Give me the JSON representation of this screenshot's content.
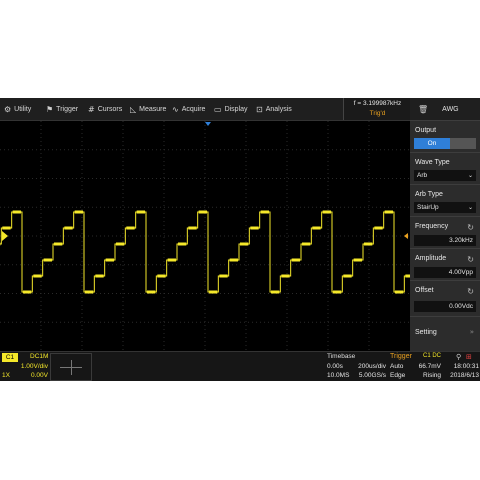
{
  "menu": {
    "items": [
      {
        "name": "utility",
        "icon": "gear-icon",
        "label": "Utility"
      },
      {
        "name": "trigger",
        "icon": "flag-icon",
        "label": "Trigger"
      },
      {
        "name": "cursors",
        "icon": "hash-icon",
        "label": "Cursors"
      },
      {
        "name": "measure",
        "icon": "ruler-icon",
        "label": "Measure"
      },
      {
        "name": "acquire",
        "icon": "wave-icon",
        "label": "Acquire"
      },
      {
        "name": "display",
        "icon": "monitor-icon",
        "label": "Display"
      },
      {
        "name": "analysis",
        "icon": "chart-icon",
        "label": "Analysis"
      }
    ]
  },
  "trigger_status": {
    "frequency": "f = 3.199987kHz",
    "state": "Trig'd"
  },
  "awg": {
    "title": "AWG",
    "output_label": "Output",
    "output_value": "On",
    "wave_type_label": "Wave Type",
    "wave_type_value": "Arb",
    "arb_type_label": "Arb Type",
    "arb_type_value": "StairUp",
    "frequency_label": "Frequency",
    "frequency_value": "3.20kHz",
    "amplitude_label": "Amplitude",
    "amplitude_value": "4.00Vpp",
    "offset_label": "Offset",
    "offset_value": "0.00Vdc",
    "setting_label": "Setting"
  },
  "channel": {
    "name": "C1",
    "coupling": "DC1M",
    "scale": "1.00V/div",
    "probe": "1X",
    "offset": "0.00V"
  },
  "timebase": {
    "title": "Timebase",
    "delay": "0.00s",
    "scale": "200us/div",
    "memory": "10.0MS",
    "sample_rate": "5.00GS/s"
  },
  "trigger": {
    "title": "Trigger",
    "source": "C1 DC",
    "mode": "Auto",
    "level": "66.7mV",
    "type": "Edge",
    "slope": "Rising"
  },
  "clock": {
    "time": "18:00:31",
    "date": "2018/6/13"
  },
  "colors": {
    "trace": "#f5e82a",
    "channel_bg": "#f5e82a",
    "accent_on": "#2f7fd8",
    "trigger_label": "#e8a020",
    "marker_orange": "#e8a020"
  },
  "chart_data": {
    "type": "line",
    "title": "",
    "series": [
      {
        "shape": "staircase up",
        "steps": 6,
        "periods_visible": 6.5
      }
    ],
    "grid": "dotted 10x8"
  }
}
